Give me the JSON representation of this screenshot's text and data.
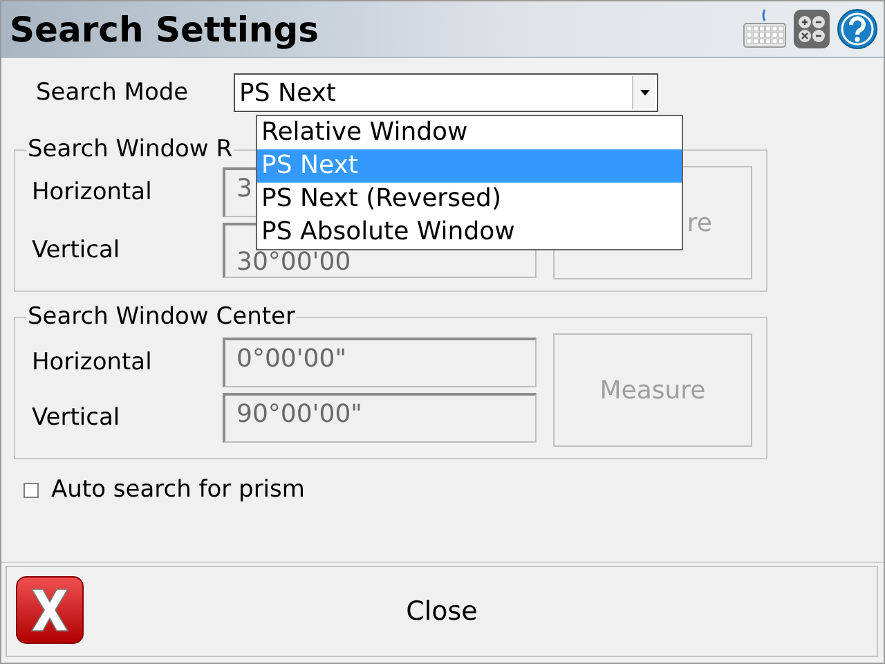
{
  "window": {
    "title": "Search Settings"
  },
  "search_mode": {
    "label": "Search Mode",
    "value": "PS Next",
    "expanded": true,
    "options": [
      {
        "label": "Relative Window",
        "selected": false
      },
      {
        "label": "PS Next",
        "selected": true
      },
      {
        "label": "PS Next (Reversed)",
        "selected": false
      },
      {
        "label": "PS Absolute Window",
        "selected": false
      }
    ]
  },
  "groups": [
    {
      "legend": "Search Window R",
      "fields": [
        {
          "label": "Horizontal",
          "value": "3"
        },
        {
          "label": "Vertical",
          "value": "30°00'00"
        }
      ],
      "button": {
        "label": "re",
        "disabled": true,
        "cut": true
      }
    },
    {
      "legend": "Search Window Center",
      "fields": [
        {
          "label": "Horizontal",
          "value": "0°00'00\""
        },
        {
          "label": "Vertical",
          "value": "90°00'00\""
        }
      ],
      "button": {
        "label": "Measure",
        "disabled": true,
        "cut": false
      }
    }
  ],
  "auto_search": {
    "label": "Auto search for prism",
    "checked": false
  },
  "close_button": {
    "label": "Close"
  }
}
